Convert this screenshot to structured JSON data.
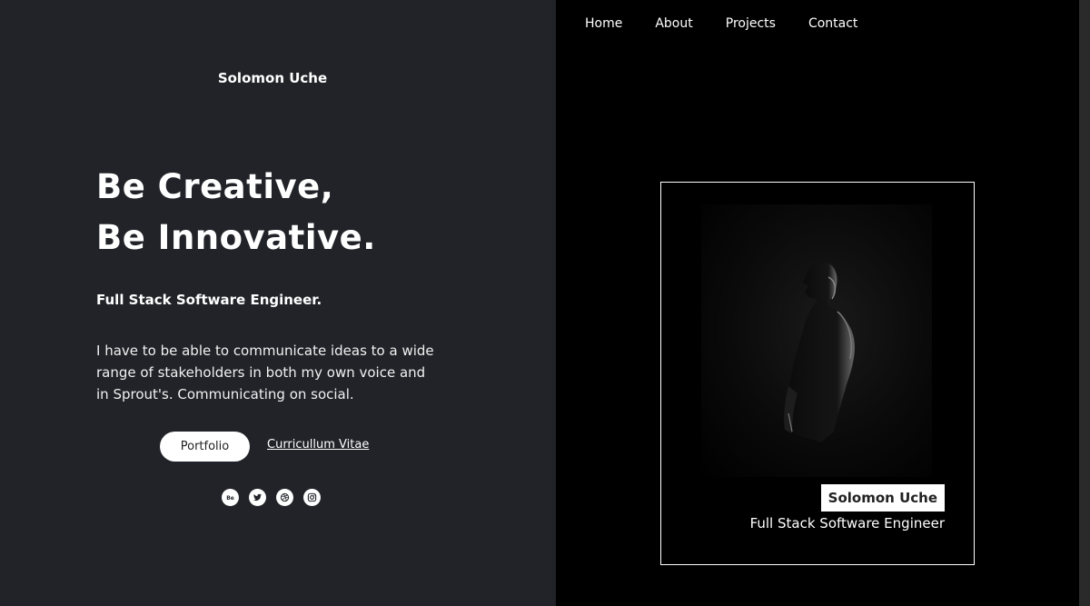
{
  "header": {
    "site_name": "Solomon Uche"
  },
  "hero": {
    "title_line1": "Be Creative,",
    "title_line2": "Be Innovative.",
    "role": "Full Stack Software Engineer.",
    "description": "I have to be able to communicate ideas to a wide range of stakeholders in both my own voice and in Sprout's. Communicating on social."
  },
  "actions": {
    "portfolio_label": "Portfolio",
    "cv_label": "Curricullum Vitae"
  },
  "socials": [
    {
      "name": "behance-icon"
    },
    {
      "name": "twitter-icon"
    },
    {
      "name": "dribbble-icon"
    },
    {
      "name": "instagram-icon"
    }
  ],
  "nav": {
    "items": [
      "Home",
      "About",
      "Projects",
      "Contact"
    ]
  },
  "card": {
    "name": "Solomon Uche",
    "role": "Full Stack Software Engineer"
  },
  "colors": {
    "left_bg": "#212328",
    "right_bg": "#000000",
    "accent": "#ffffff"
  }
}
